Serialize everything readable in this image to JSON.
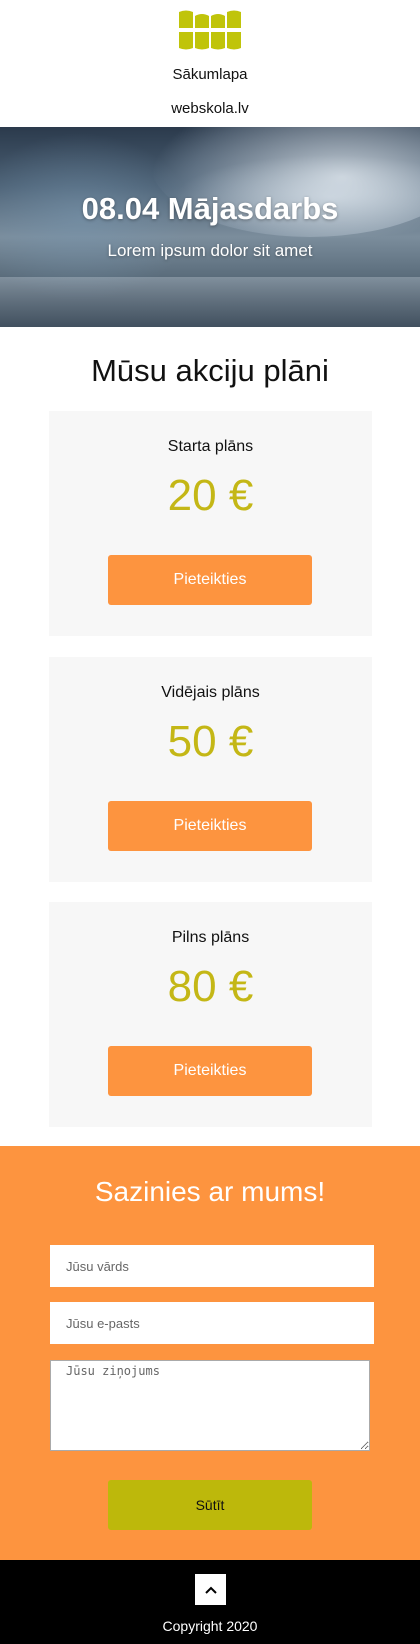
{
  "header": {
    "logo_icon": "webskola-logo-icon",
    "nav_home": "Sākumlapa",
    "nav_site": "webskola.lv"
  },
  "hero": {
    "title": "08.04 Mājasdarbs",
    "subtitle": "Lorem ipsum dolor sit amet"
  },
  "plans": {
    "title": "Mūsu akciju plāni",
    "items": [
      {
        "name": "Starta plāns",
        "price": "20 €",
        "button": "Pieteikties"
      },
      {
        "name": "Vidējais plāns",
        "price": "50 €",
        "button": "Pieteikties"
      },
      {
        "name": "Pilns plāns",
        "price": "80 €",
        "button": "Pieteikties"
      }
    ]
  },
  "contact": {
    "title": "Sazinies ar mums!",
    "name_placeholder": "Jūsu vārds",
    "email_placeholder": "Jūsu e-pasts",
    "message_placeholder": "Jūsu ziņojums",
    "send_label": "Sūtīt"
  },
  "footer": {
    "top_icon": "chevron-up-icon",
    "copyright": "Copyright 2020"
  },
  "colors": {
    "accent_orange": "#fd943f",
    "price_yellow": "#c4b716",
    "send_button": "#bdb80b",
    "logo": "#c0c40a"
  }
}
